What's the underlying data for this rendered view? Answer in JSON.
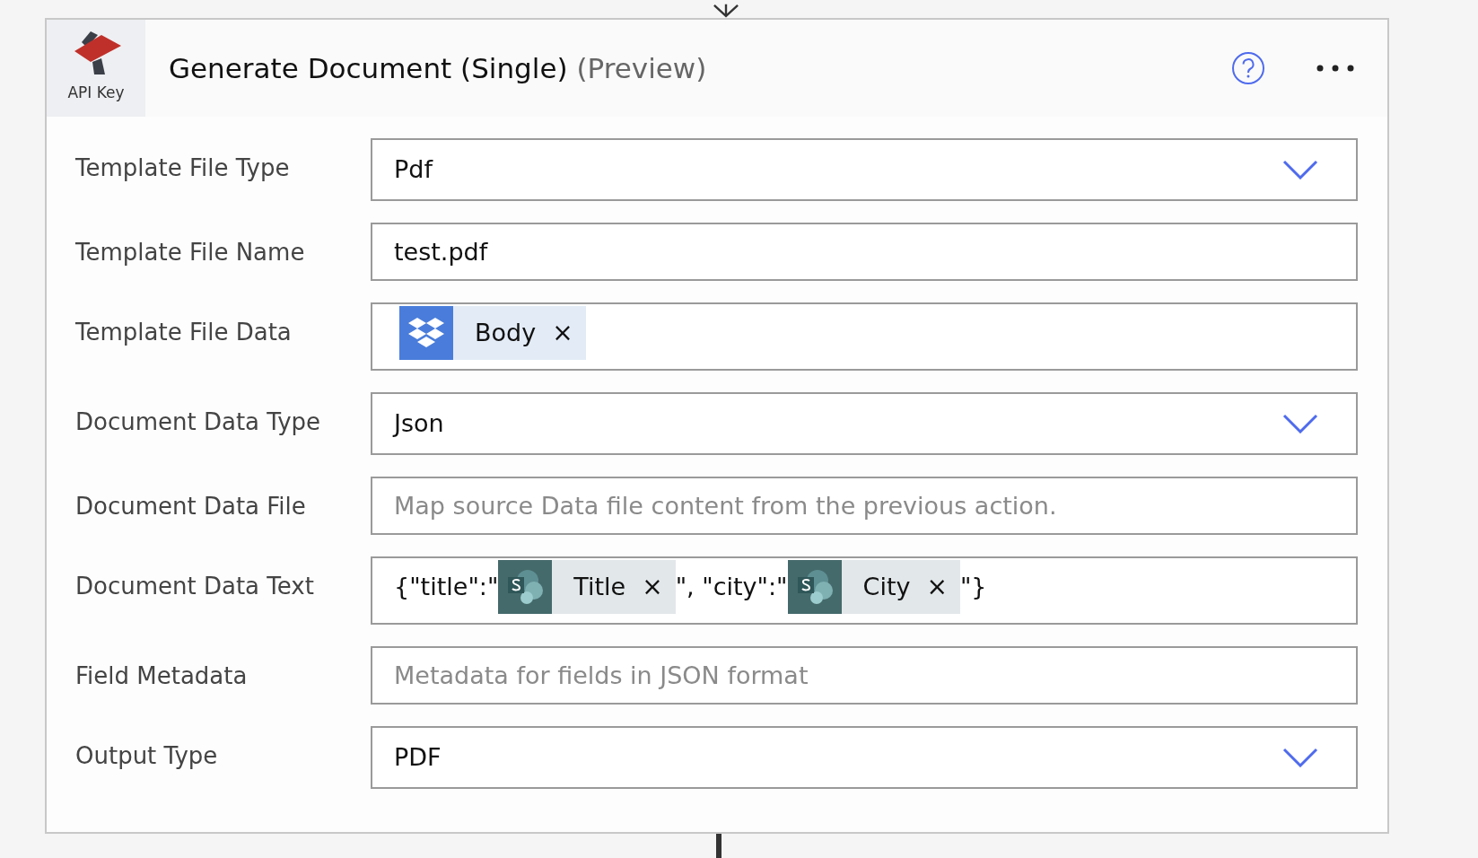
{
  "card": {
    "logo_caption": "API Key",
    "title": "Generate Document (Single)",
    "title_suffix": "(Preview)"
  },
  "fields": [
    {
      "label": "Template File Type",
      "kind": "dropdown",
      "value": "Pdf"
    },
    {
      "label": "Template File Name",
      "kind": "text",
      "value": "test.pdf"
    },
    {
      "label": "Template File Data",
      "kind": "tokens",
      "parts": [
        {
          "kind": "dropbox-token",
          "text": "Body",
          "remove": "×"
        }
      ]
    },
    {
      "label": "Document Data Type",
      "kind": "dropdown",
      "value": "Json"
    },
    {
      "label": "Document Data File",
      "kind": "text",
      "placeholder": "Map source Data file content from the previous action."
    },
    {
      "label": "Document Data Text",
      "kind": "tokens",
      "parts": [
        {
          "kind": "text",
          "text": "{\"title\":\""
        },
        {
          "kind": "sharepoint-token",
          "text": "Title",
          "remove": "×"
        },
        {
          "kind": "text",
          "text": "\", \"city\":\""
        },
        {
          "kind": "sharepoint-token",
          "text": "City",
          "remove": "×"
        },
        {
          "kind": "text",
          "text": "\"}"
        }
      ]
    },
    {
      "label": "Field Metadata",
      "kind": "text",
      "placeholder": "Metadata for fields in JSON format"
    },
    {
      "label": "Output Type",
      "kind": "dropdown",
      "value": "PDF"
    }
  ]
}
